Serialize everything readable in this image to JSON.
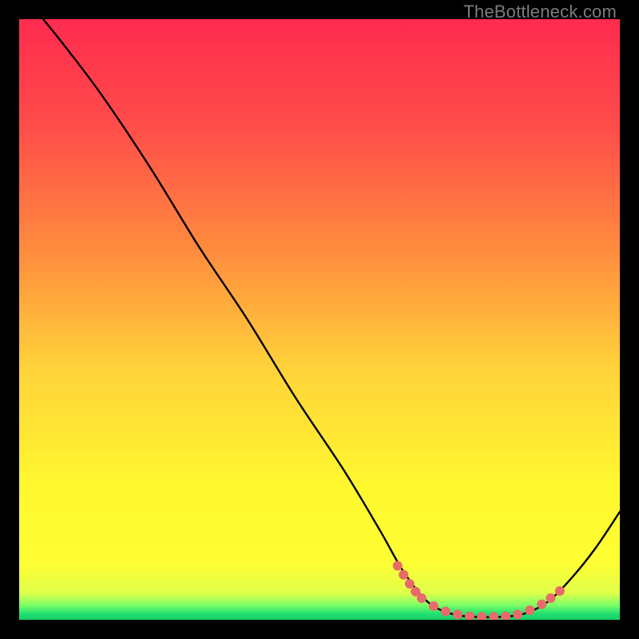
{
  "watermark": "TheBottleneck.com",
  "chart_data": {
    "type": "line",
    "title": "",
    "xlabel": "",
    "ylabel": "",
    "xlim": [
      0,
      100
    ],
    "ylim": [
      0,
      100
    ],
    "gradient_stops": [
      {
        "offset": 0.0,
        "color": "#ff2b4f"
      },
      {
        "offset": 0.18,
        "color": "#ff4d4a"
      },
      {
        "offset": 0.38,
        "color": "#ff8a3e"
      },
      {
        "offset": 0.58,
        "color": "#ffd23a"
      },
      {
        "offset": 0.78,
        "color": "#fff82f"
      },
      {
        "offset": 0.905,
        "color": "#ffff33"
      },
      {
        "offset": 0.955,
        "color": "#e0ff4a"
      },
      {
        "offset": 0.975,
        "color": "#7fff66"
      },
      {
        "offset": 0.99,
        "color": "#20e070"
      },
      {
        "offset": 1.0,
        "color": "#18cc66"
      }
    ],
    "series": [
      {
        "name": "bottleneck-curve",
        "color": "#000000",
        "points": [
          {
            "x": 4,
            "y": 100
          },
          {
            "x": 8,
            "y": 95
          },
          {
            "x": 14,
            "y": 87
          },
          {
            "x": 22,
            "y": 75
          },
          {
            "x": 30,
            "y": 62
          },
          {
            "x": 38,
            "y": 50
          },
          {
            "x": 46,
            "y": 37
          },
          {
            "x": 54,
            "y": 25
          },
          {
            "x": 60,
            "y": 15
          },
          {
            "x": 64,
            "y": 8
          },
          {
            "x": 68,
            "y": 3
          },
          {
            "x": 72,
            "y": 1
          },
          {
            "x": 76,
            "y": 0.5
          },
          {
            "x": 80,
            "y": 0.5
          },
          {
            "x": 84,
            "y": 1
          },
          {
            "x": 88,
            "y": 3
          },
          {
            "x": 92,
            "y": 7
          },
          {
            "x": 96,
            "y": 12
          },
          {
            "x": 100,
            "y": 18
          }
        ]
      }
    ],
    "marker_series": {
      "name": "highlight-dots",
      "color": "#e96a6a",
      "radius": 6,
      "points": [
        {
          "x": 63,
          "y": 9
        },
        {
          "x": 64,
          "y": 7.5
        },
        {
          "x": 65,
          "y": 6
        },
        {
          "x": 66,
          "y": 4.7
        },
        {
          "x": 67,
          "y": 3.6
        },
        {
          "x": 69,
          "y": 2.3
        },
        {
          "x": 71,
          "y": 1.4
        },
        {
          "x": 73,
          "y": 0.9
        },
        {
          "x": 75,
          "y": 0.6
        },
        {
          "x": 77,
          "y": 0.5
        },
        {
          "x": 79,
          "y": 0.5
        },
        {
          "x": 81,
          "y": 0.6
        },
        {
          "x": 83,
          "y": 0.9
        },
        {
          "x": 85,
          "y": 1.6
        },
        {
          "x": 87,
          "y": 2.6
        },
        {
          "x": 88.5,
          "y": 3.6
        },
        {
          "x": 90,
          "y": 4.8
        }
      ]
    }
  }
}
